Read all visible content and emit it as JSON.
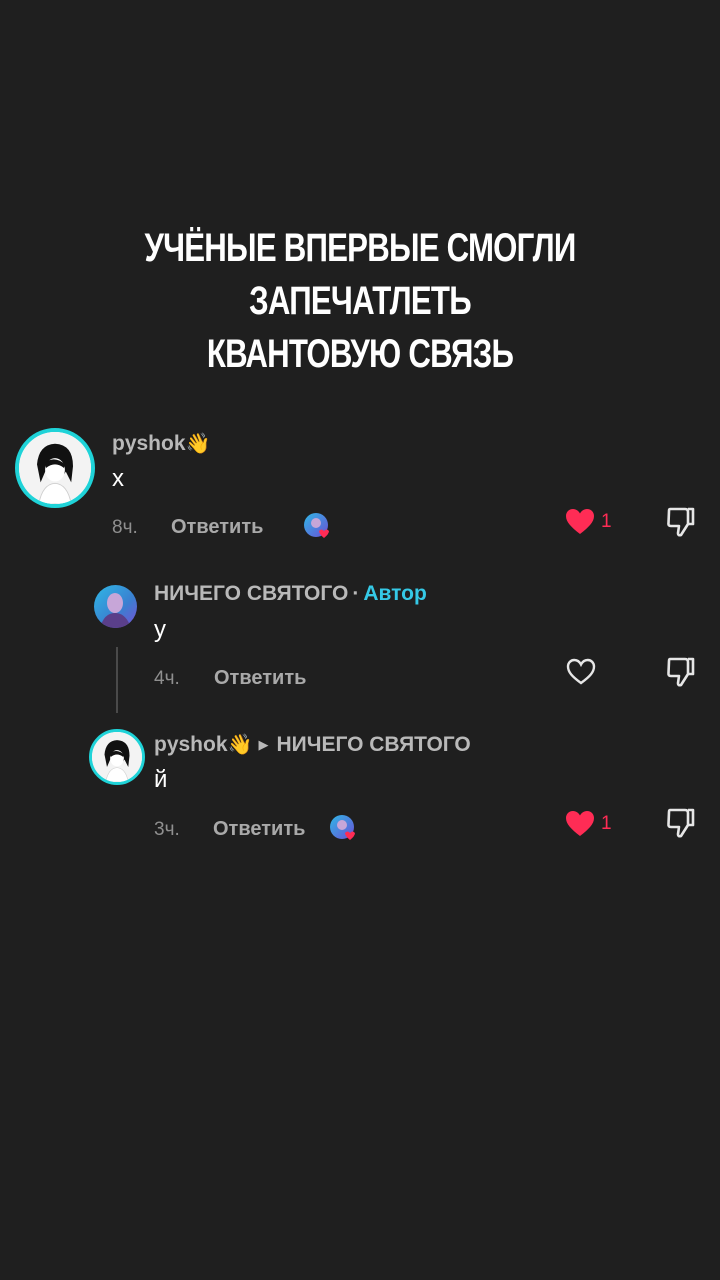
{
  "headline": {
    "line1": "УЧЁНЫЕ ВПЕРВЫЕ СМОГЛИ",
    "line2": "ЗАПЕЧАТЛЕТЬ",
    "line3": "КВАНТОВУЮ СВЯЗЬ"
  },
  "colors": {
    "background": "#1f1f1f",
    "like_red": "#ff2c55",
    "author_accent": "#35c9e6",
    "ring": "#1fd3d8"
  },
  "comments": [
    {
      "username": "pyshok",
      "username_emoji": "👋",
      "text": "х",
      "time": "8ч.",
      "reply_label": "Ответить",
      "liked": true,
      "likes": "1",
      "liked_by_author_icon": "author-heart-avatar-icon",
      "dislike_icon": "thumbs-down-icon"
    },
    {
      "username": "НИЧЕГО СВЯТОГО",
      "separator": "·",
      "author_tag": "Автор",
      "text": "у",
      "time": "4ч.",
      "reply_label": "Ответить",
      "liked": false,
      "like_icon": "heart-outline-icon",
      "dislike_icon": "thumbs-down-icon"
    },
    {
      "username": "pyshok",
      "username_emoji": "👋",
      "reply_arrow": "▶",
      "reply_to": "НИЧЕГО СВЯТОГО",
      "text": "й",
      "time": "3ч.",
      "reply_label": "Ответить",
      "liked": true,
      "likes": "1",
      "liked_by_author_icon": "author-heart-avatar-icon",
      "dislike_icon": "thumbs-down-icon"
    }
  ]
}
